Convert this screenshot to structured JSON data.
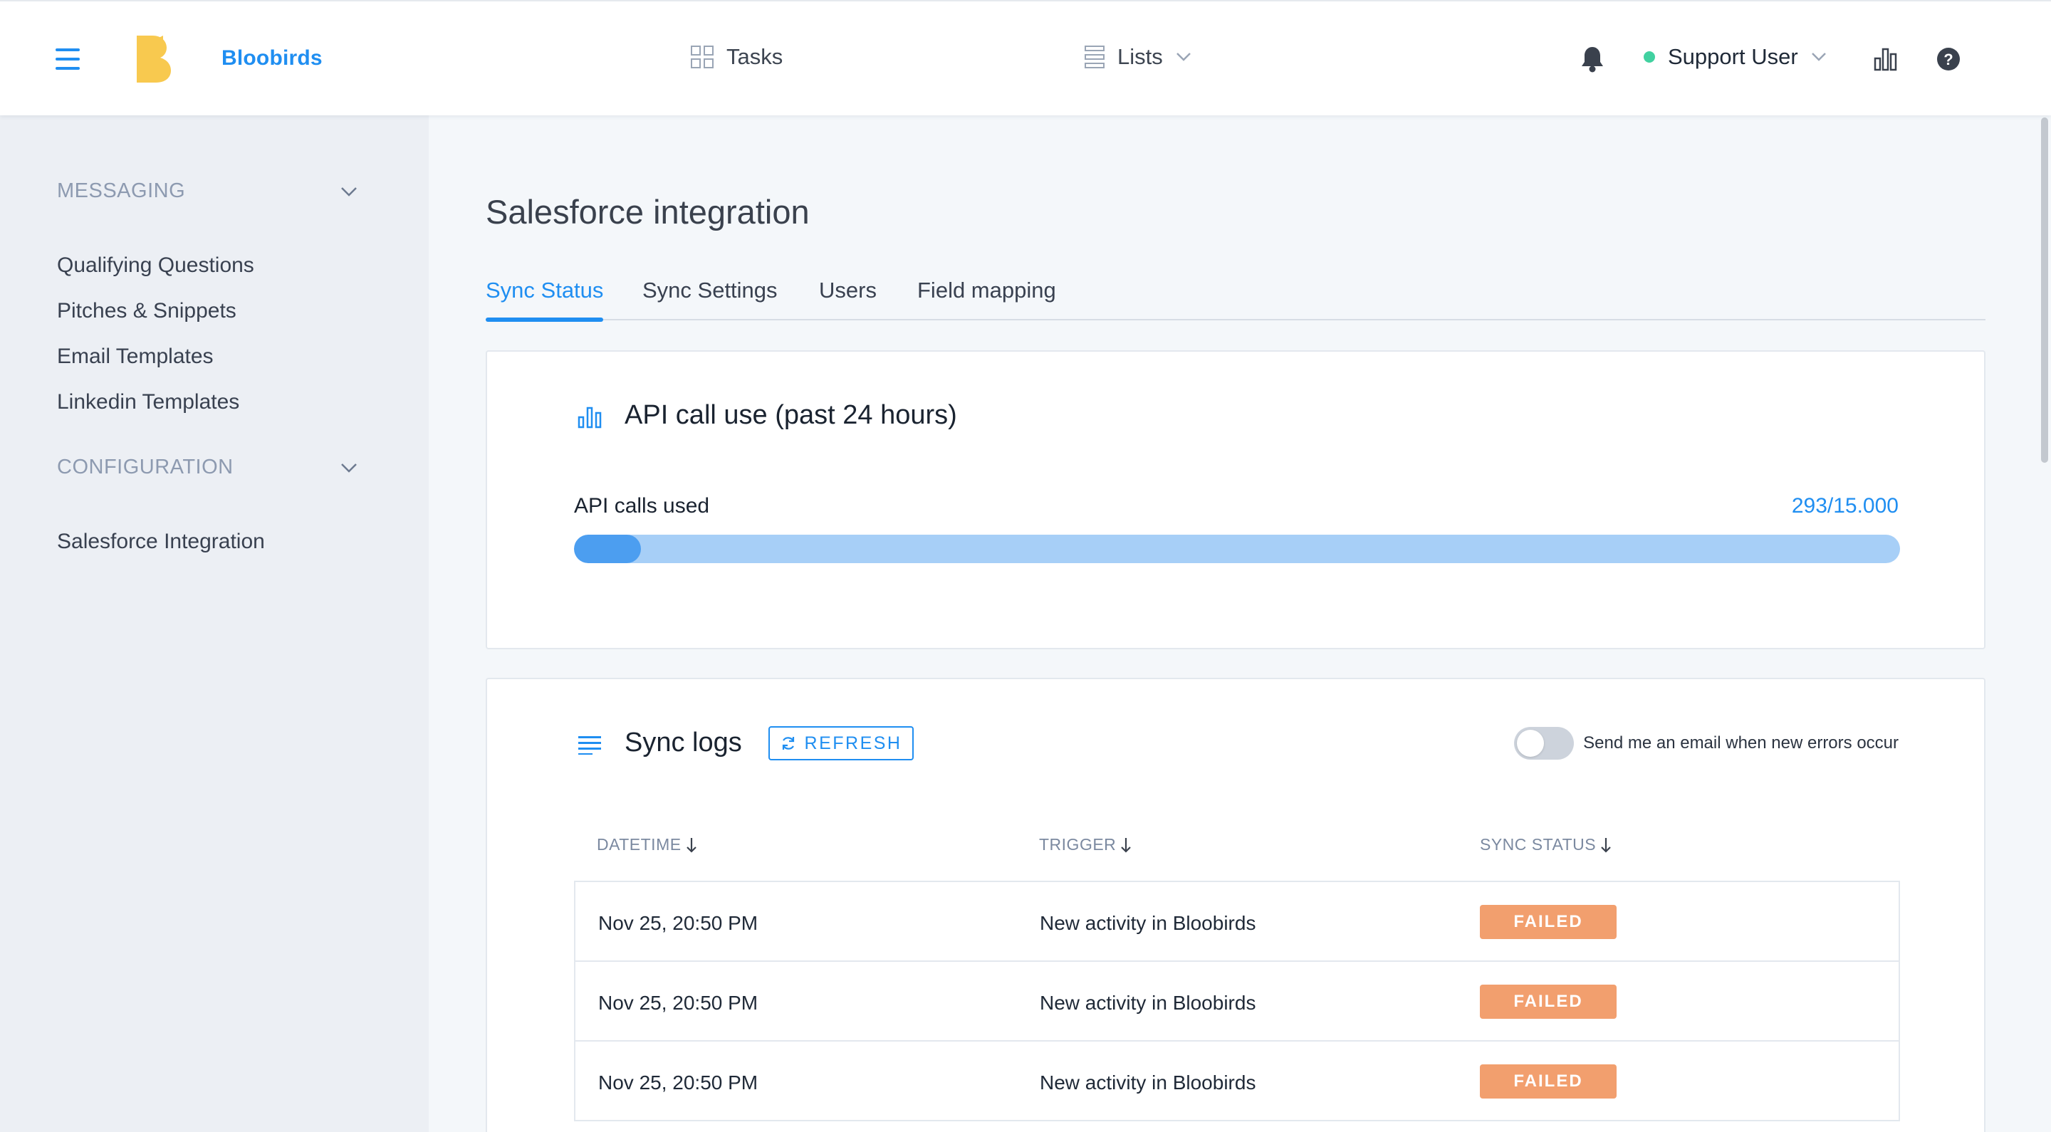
{
  "header": {
    "brand": "Bloobirds",
    "tasks_label": "Tasks",
    "lists_label": "Lists",
    "user_name": "Support User",
    "user_status_color": "#41d1a0",
    "icons": [
      "menu-icon",
      "bloobirds-logo",
      "grid-icon",
      "list-icon",
      "chevron-down-icon",
      "bell-icon",
      "bar-chart-icon",
      "help-icon"
    ]
  },
  "sidebar": {
    "sections": [
      {
        "title": "MESSAGING",
        "items": [
          "Qualifying Questions",
          "Pitches & Snippets",
          "Email Templates",
          "Linkedin Templates"
        ]
      },
      {
        "title": "CONFIGURATION",
        "items": [
          "Salesforce Integration"
        ]
      }
    ]
  },
  "main": {
    "title": "Salesforce integration",
    "tabs": [
      {
        "label": "Sync Status",
        "active": true
      },
      {
        "label": "Sync Settings",
        "active": false
      },
      {
        "label": "Users",
        "active": false
      },
      {
        "label": "Field mapping",
        "active": false
      }
    ],
    "api_card": {
      "title": "API call use (past 24 hours)",
      "label": "API calls used",
      "value_text": "293/15.000",
      "used": 293,
      "total": 15000
    },
    "sync_logs": {
      "title": "Sync logs",
      "refresh_label": "REFRESH",
      "toggle_label": "Send me an email when new errors occur",
      "toggle_on": false,
      "columns": [
        "DATETIME",
        "TRIGGER",
        "SYNC STATUS"
      ],
      "rows": [
        {
          "datetime": "Nov 25, 20:50 PM",
          "trigger": "New activity in Bloobirds",
          "status": "FAILED"
        },
        {
          "datetime": "Nov 25, 20:50 PM",
          "trigger": "New activity in Bloobirds",
          "status": "FAILED"
        },
        {
          "datetime": "Nov 25, 20:50 PM",
          "trigger": "New activity in Bloobirds",
          "status": "FAILED"
        }
      ]
    }
  },
  "colors": {
    "accent": "#1f8ef1",
    "failed_badge": "#f29f6e",
    "logo": "#f8c94f"
  }
}
